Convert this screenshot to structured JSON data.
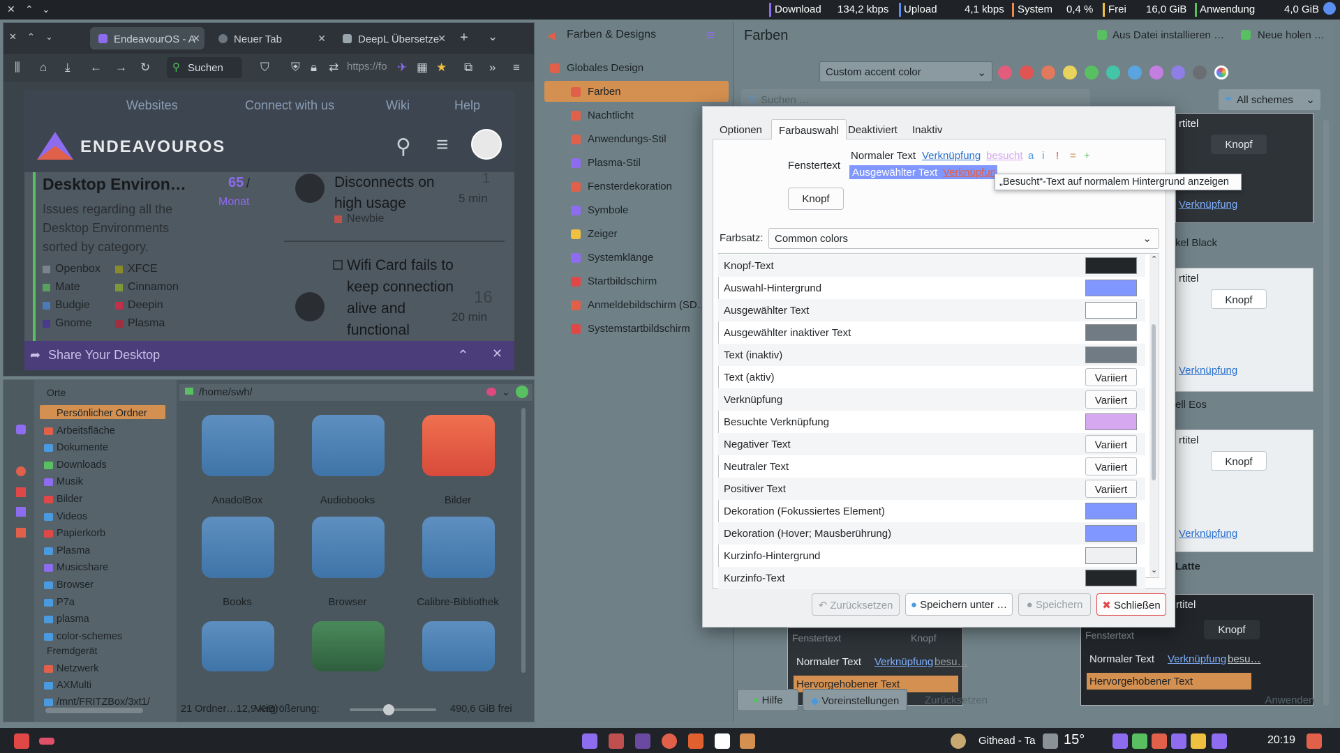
{
  "topbar": {
    "download_label": "Download",
    "download_value": "134,2 kbps",
    "upload_label": "Upload",
    "upload_value": "4,1 kbps",
    "system_label": "System",
    "system_value": "0,4 %",
    "free_label": "Frei",
    "free_value": "16,0 GiB",
    "app_label": "Anwendung",
    "app_value": "4,0 GiB"
  },
  "browser": {
    "tabs": [
      "EndeavourOS - A",
      "Neuer Tab",
      "DeepL Übersetze"
    ],
    "search_label": "Suchen",
    "url": "https://fo",
    "site_nav": [
      "Websites",
      "Connect with us",
      "Wiki",
      "Help"
    ],
    "logo": "ENDEAVOUROS",
    "category_title": "Desktop Environ…",
    "category_count": "65",
    "category_unit": "Monat",
    "category_desc": "Issues regarding all the Desktop Environments sorted by category.",
    "subcats": [
      "Openbox",
      "XFCE",
      "Mate",
      "Cinnamon",
      "Budgie",
      "Deepin",
      "Gnome",
      "Plasma"
    ],
    "topic1_title": "Disconnects on high usage",
    "topic1_tag": "Newbie",
    "topic1_count": "1",
    "topic1_time": "5 min",
    "topic2_title": "Wifi Card fails to keep connection alive and functional",
    "topic2_count": "16",
    "topic2_time": "20 min",
    "share": "Share Your Desktop"
  },
  "filemanager": {
    "places_title": "Orte",
    "places": [
      "Persönlicher Ordner",
      "Arbeitsfläche",
      "Dokumente",
      "Downloads",
      "Musik",
      "Bilder",
      "Videos",
      "Papierkorb",
      "Plasma",
      "Musicshare",
      "Browser",
      "P7a",
      "plasma",
      "color-schemes"
    ],
    "devices_title": "Fremdgerät",
    "devices": [
      "Netzwerk",
      "AXMulti",
      "/mnt/FRITZBox/3xt1/"
    ],
    "path": "/home/swh/",
    "folders": [
      "AnadolBox",
      "Audiobooks",
      "Bilder",
      "Books",
      "Browser",
      "Calibre-Bibliothek"
    ],
    "status": "21 Ordner…12,9 KiB)",
    "zoom_label": "Vergrößerung:",
    "free": "490,6 GiB frei"
  },
  "settings": {
    "section": "Farben & Designs",
    "page_title": "Farben",
    "install_btn": "Aus Datei installieren …",
    "new_btn": "Neue holen …",
    "accent_select": "Custom accent color",
    "search_placeholder": "Suchen …",
    "schemes_filter": "All schemes",
    "items": [
      "Globales Design",
      "Farben",
      "Nachtlicht",
      "Anwendungs-Stil",
      "Plasma-Stil",
      "Fensterdekoration",
      "Symbole",
      "Zeiger",
      "Systemklänge",
      "Startbildschirm",
      "Anmeldebildschirm (SD…",
      "Systemstartbildschirm"
    ],
    "accent_colors": [
      "#e25c7c",
      "#e05454",
      "#e2785c",
      "#e8d45c",
      "#58c060",
      "#44c4a8",
      "#5aa4e0",
      "#c47ee0",
      "#8e7ee6",
      "#6a6e72"
    ],
    "scheme_names": [
      "kel Black",
      "ell Eos",
      "Latte"
    ],
    "preview_title": "rtitel",
    "preview_button": "Knopf",
    "preview_link": "Verknüpfung",
    "preview_visited": "besu…",
    "preview_normal": "Normaler Text",
    "preview_highlight": "Hervorgehobener Text",
    "preview_fenster": "Fenstertext",
    "help_btn": "Hilfe",
    "defaults_btn": "Voreinstellungen",
    "reset_btn": "Zurücksetzen",
    "apply_btn": "Anwenden"
  },
  "dialog": {
    "tabs": [
      "Optionen",
      "Farbauswahl",
      "Deaktiviert",
      "Inaktiv"
    ],
    "window_text_label": "Fenstertext",
    "normal_text": "Normaler Text",
    "link_text": "Verknüpfung",
    "visited_text": "besucht",
    "selected_text": "Ausgewählter Text",
    "selected_link": "Verknüpfung",
    "sample_chars": [
      "a",
      "i",
      "!",
      "=",
      "+"
    ],
    "tooltip": "„Besucht“-Text auf normalem Hintergrund anzeigen",
    "button": "Knopf",
    "colorset_label": "Farbsatz:",
    "colorset_value": "Common colors",
    "variant_label": "Variiert",
    "rows": [
      {
        "label": "Knopf-Text",
        "color": "#232629"
      },
      {
        "label": "Auswahl-Hintergrund",
        "color": "#7f97ff"
      },
      {
        "label": "Ausgewählter Text",
        "color": "#ffffff"
      },
      {
        "label": "Ausgewählter inaktiver Text",
        "color": "#717b84"
      },
      {
        "label": "Text (inaktiv)",
        "color": "#717b84"
      },
      {
        "label": "Text (aktiv)",
        "color": ""
      },
      {
        "label": "Verknüpfung",
        "color": ""
      },
      {
        "label": "Besuchte Verknüpfung",
        "color": "#d6a8f0"
      },
      {
        "label": "Negativer Text",
        "color": ""
      },
      {
        "label": "Neutraler Text",
        "color": ""
      },
      {
        "label": "Positiver Text",
        "color": ""
      },
      {
        "label": "Dekoration (Fokussiertes Element)",
        "color": "#7f97ff"
      },
      {
        "label": "Dekoration (Hover; Mausberührung)",
        "color": "#7f97ff"
      },
      {
        "label": "Kurzinfo-Hintergrund",
        "color": "#eff0f1"
      },
      {
        "label": "Kurzinfo-Text",
        "color": "#232629"
      }
    ],
    "reset_btn": "Zurücksetzen",
    "save_as_btn": "Speichern unter …",
    "save_btn": "Speichern",
    "close_btn": "Schließen"
  },
  "taskbar": {
    "weather_label": "Githead - Ta",
    "temperature": "15°",
    "clock": "20:19"
  }
}
